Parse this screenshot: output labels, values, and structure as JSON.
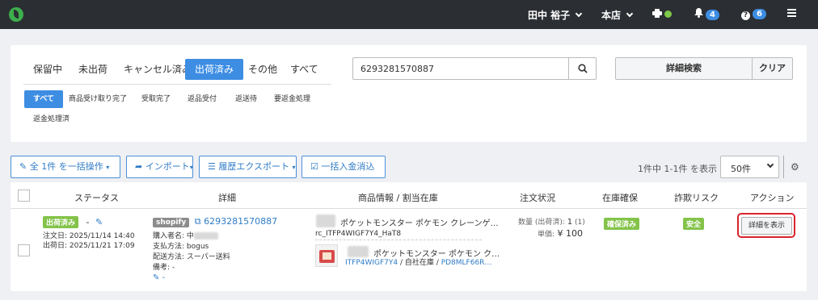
{
  "topbar": {
    "user_name": "田中 裕子",
    "store": "本店",
    "notifications_count": "4",
    "help_count": "6"
  },
  "tabs": [
    "保留中",
    "未出荷",
    "キャンセル済み",
    "出荷済み",
    "その他",
    "すべて"
  ],
  "subtabs": [
    "すべて",
    "商品受け取り完了",
    "受取完了",
    "返品受付",
    "返送待",
    "要返金処理",
    "返金処理済"
  ],
  "search": {
    "value": "6293281570887",
    "detail_label": "詳細検索",
    "clear_label": "クリア"
  },
  "toolbar": {
    "bulk_label": "全 1件 を一括操作",
    "import_label": "インポート",
    "export_label": "履歴エクスポート",
    "payment_label": "一括入金消込",
    "paging_text": "1件中 1-1件 を表示",
    "per_page": "50件"
  },
  "columns": [
    "ステータス",
    "詳細",
    "商品情報 / 割当在庫",
    "注文状況",
    "在庫確保",
    "詐欺リスク",
    "アクション"
  ],
  "row": {
    "status": "出荷済み",
    "dash": "-",
    "order_date": "注文日: 2025/11/14 14:40",
    "ship_date": "出荷日: 2025/11/21 17:09",
    "shop": "shopify",
    "order_no": "6293281570887",
    "buyer": "購入者名: 中",
    "payment": "支払方法: bogus",
    "delivery": "配送方法: スーパー送料",
    "note": "備考: -",
    "note_edit": "-",
    "product1_name": "ポケットモンスター ポケモン クレーンゲ…",
    "product1_sku": "rc_ITFP4WIGF7Y4_HaT8",
    "product2_name": "ポケットモンスター ポケモン ク…",
    "product2_sku": "ITFP4WIGF7Y4",
    "product2_stock": "/ 自社在庫 /",
    "product2_loc": "PD8MLF66R…",
    "qty_label": "数量 (出荷済):",
    "qty_value": "1",
    "qty_sub": "(1)",
    "price_label": "単価:",
    "price_value": "¥ 100",
    "stock": "確保済み",
    "fraud": "安全",
    "action_label": "詳細を表示"
  }
}
